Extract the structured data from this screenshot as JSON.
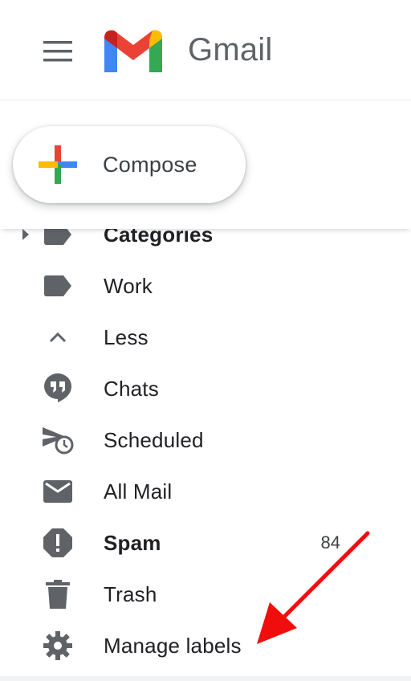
{
  "header": {
    "app_name": "Gmail",
    "menu_icon": "hamburger-menu-icon",
    "logo_icon": "gmail-m-logo"
  },
  "compose": {
    "label": "Compose",
    "icon": "plus-icon"
  },
  "nav": {
    "items": [
      {
        "label": "Categories",
        "icon": "label-icon",
        "bold": true
      },
      {
        "label": "Work",
        "icon": "label-icon"
      },
      {
        "label": "Less",
        "icon": "chevron-up-icon"
      },
      {
        "label": "Chats",
        "icon": "chat-quote-icon"
      },
      {
        "label": "Scheduled",
        "icon": "scheduled-send-icon"
      },
      {
        "label": "All Mail",
        "icon": "mail-icon"
      },
      {
        "label": "Spam",
        "icon": "spam-icon",
        "bold": true,
        "count": "84"
      },
      {
        "label": "Trash",
        "icon": "trash-icon"
      },
      {
        "label": "Manage labels",
        "icon": "gear-icon"
      }
    ]
  },
  "annotation": {
    "color": "#f20d0d"
  },
  "colors": {
    "icon_gray": "#5f6368",
    "text": "#202124",
    "gmail_red": "#ea4335",
    "gmail_blue": "#4285f4",
    "gmail_green": "#34a853",
    "gmail_yellow": "#fbbc04"
  }
}
